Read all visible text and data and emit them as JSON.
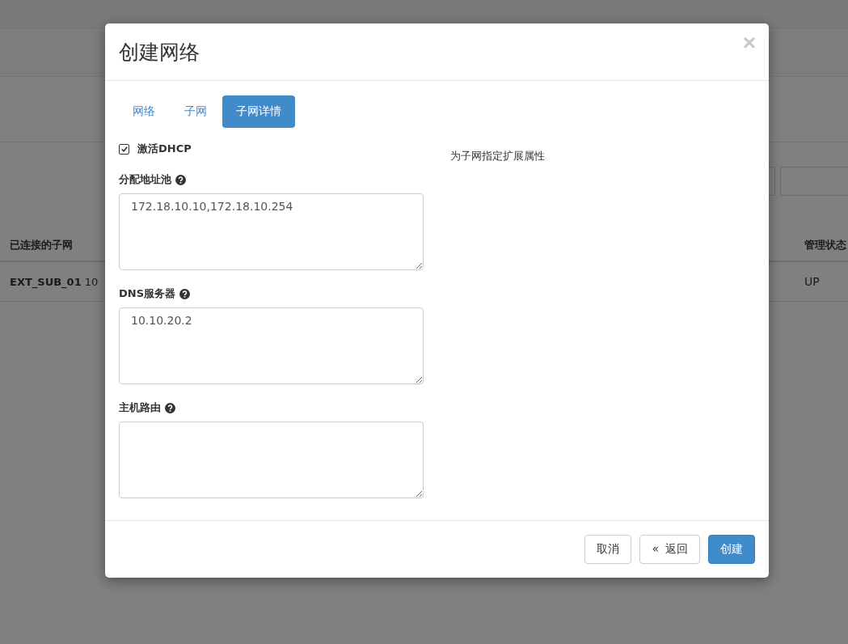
{
  "background_page": {
    "table": {
      "columns": [
        "已连接的子网",
        "管理状态"
      ],
      "rows": [
        {
          "name": "EXT_SUB_01",
          "cidr": "10",
          "admin_state": "UP"
        }
      ]
    }
  },
  "dialog": {
    "title": "创建网络",
    "close": "×",
    "tabs": [
      {
        "label": "网络",
        "selected": false
      },
      {
        "label": "子网",
        "selected": false
      },
      {
        "label": "子网详情",
        "selected": true
      }
    ],
    "dhcp": {
      "label": "激活DHCP",
      "checked": true
    },
    "fields": [
      {
        "label": "分配地址池",
        "value": "172.18.10.10,172.18.10.254"
      },
      {
        "label": "DNS服务器",
        "value": "10.10.20.2"
      },
      {
        "label": "主机路由"
      }
    ],
    "help_text": "为子网指定扩展属性",
    "buttons": [
      {
        "label": "取消",
        "kind": "default"
      },
      {
        "label": "返回",
        "kind": "back",
        "prefix": "«"
      },
      {
        "label": "创建",
        "kind": "primary"
      }
    ]
  }
}
